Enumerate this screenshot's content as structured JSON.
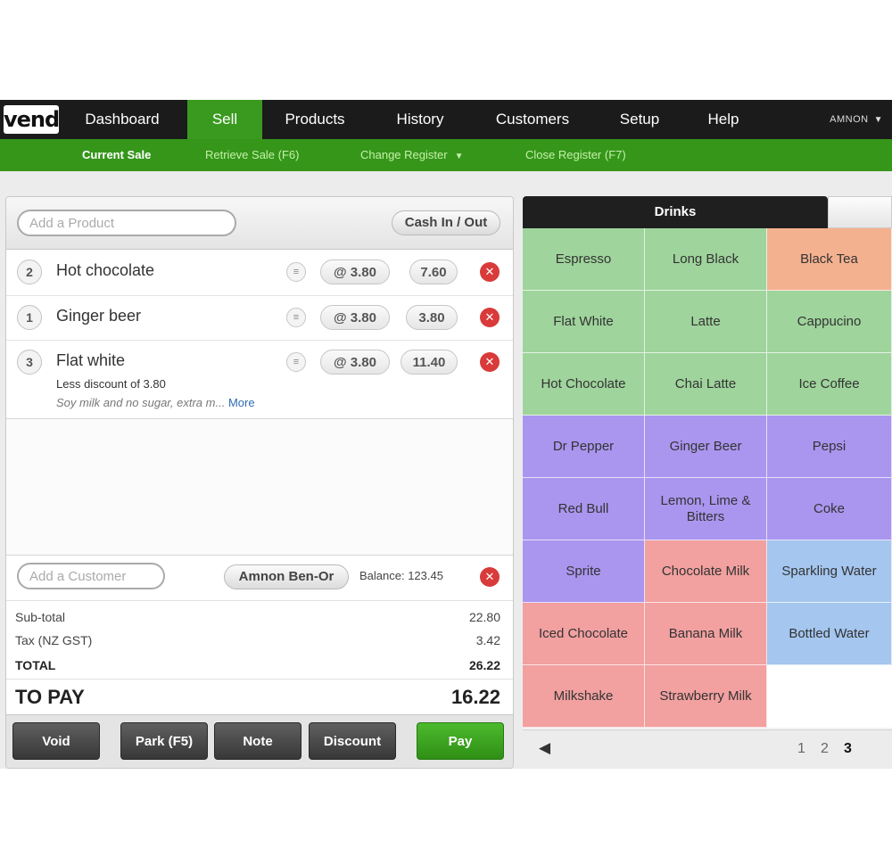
{
  "brand": {
    "logo_text": "vend"
  },
  "nav": {
    "tabs": [
      {
        "label": "Dashboard"
      },
      {
        "label": "Sell"
      },
      {
        "label": "Products"
      },
      {
        "label": "History"
      },
      {
        "label": "Customers"
      },
      {
        "label": "Setup"
      },
      {
        "label": "Help"
      }
    ],
    "active_tab": "Sell",
    "user": "AMNON"
  },
  "subnav": {
    "items": [
      {
        "label": "Current Sale"
      },
      {
        "label": "Retrieve Sale (F6)"
      },
      {
        "label": "Change Register"
      },
      {
        "label": "Close Register (F7)"
      }
    ],
    "active_item": "Current Sale"
  },
  "sale": {
    "add_product_placeholder": "Add a Product",
    "cash_button": "Cash In / Out",
    "lines": [
      {
        "qty": "2",
        "name": "Hot chocolate",
        "unit": "@ 3.80",
        "total": "7.60"
      },
      {
        "qty": "1",
        "name": "Ginger beer",
        "unit": "@ 3.80",
        "total": "3.80"
      },
      {
        "qty": "3",
        "name": "Flat white",
        "unit": "@ 3.80",
        "total": "11.40",
        "discount": "Less discount of 3.80",
        "note": "Soy milk and no sugar, extra m...",
        "more": "More"
      }
    ],
    "add_customer_placeholder": "Add a Customer",
    "customer_name": "Amnon Ben-Or",
    "balance": "Balance: 123.45",
    "totals": {
      "subtotal_label": "Sub-total",
      "subtotal": "22.80",
      "tax_label": "Tax (NZ GST)",
      "tax": "3.42",
      "total_label": "TOTAL",
      "total": "26.22",
      "topay_label": "TO PAY",
      "topay": "16.22"
    },
    "actions": {
      "void": "Void",
      "park": "Park (F5)",
      "note": "Note",
      "discount": "Discount",
      "pay": "Pay"
    }
  },
  "quickkeys": {
    "tab_label": "Drinks",
    "tiles": [
      {
        "label": "Espresso",
        "color": "#9fd49c"
      },
      {
        "label": "Long Black",
        "color": "#9fd49c"
      },
      {
        "label": "Black Tea",
        "color": "#f4b190"
      },
      {
        "label": "Flat White",
        "color": "#9fd49c"
      },
      {
        "label": "Latte",
        "color": "#9fd49c"
      },
      {
        "label": "Cappucino",
        "color": "#9fd49c"
      },
      {
        "label": "Hot Chocolate",
        "color": "#9fd49c"
      },
      {
        "label": "Chai Latte",
        "color": "#9fd49c"
      },
      {
        "label": "Ice Coffee",
        "color": "#9fd49c"
      },
      {
        "label": "Dr Pepper",
        "color": "#aa96ef"
      },
      {
        "label": "Ginger Beer",
        "color": "#aa96ef"
      },
      {
        "label": "Pepsi",
        "color": "#aa96ef"
      },
      {
        "label": "Red Bull",
        "color": "#aa96ef"
      },
      {
        "label": "Lemon, Lime & Bitters",
        "color": "#aa96ef"
      },
      {
        "label": "Coke",
        "color": "#aa96ef"
      },
      {
        "label": "Sprite",
        "color": "#aa96ef"
      },
      {
        "label": "Chocolate Milk",
        "color": "#f2a0a0"
      },
      {
        "label": "Sparkling Water",
        "color": "#a4c6ef"
      },
      {
        "label": "Iced Chocolate",
        "color": "#f2a0a0"
      },
      {
        "label": "Banana Milk",
        "color": "#f2a0a0"
      },
      {
        "label": "Bottled Water",
        "color": "#a4c6ef"
      },
      {
        "label": "Milkshake",
        "color": "#f2a0a0"
      },
      {
        "label": "Strawberry Milk",
        "color": "#f2a0a0"
      },
      {
        "label": "",
        "color": "#ffffff"
      }
    ],
    "pager": {
      "prev_icon": "triangle-left-icon",
      "pages": [
        "1",
        "2",
        "3"
      ],
      "current_page": "3"
    }
  },
  "icons": {
    "remove": "remove-circle-icon",
    "line_menu": "line-menu-icon",
    "caret": "caret-down-icon"
  }
}
